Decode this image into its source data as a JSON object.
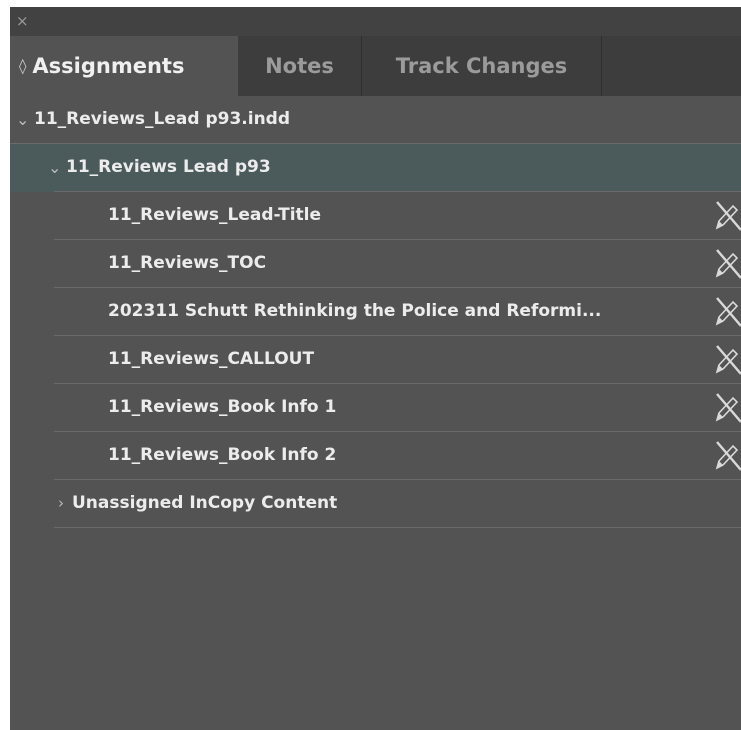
{
  "panel": {
    "close_glyph": "×"
  },
  "tabs": [
    {
      "label": "Assignments",
      "active": true
    },
    {
      "label": "Notes",
      "active": false
    },
    {
      "label": "Track Changes",
      "active": false
    }
  ],
  "tree": {
    "document": {
      "label": "11_Reviews_Lead p93.indd",
      "expanded": true
    },
    "assignment": {
      "label": "11_Reviews Lead p93",
      "expanded": true,
      "selected": true
    },
    "stories": [
      {
        "label": "11_Reviews_Lead-Title",
        "icon": "pencil-crossed-icon"
      },
      {
        "label": "11_Reviews_TOC",
        "icon": "pencil-crossed-icon"
      },
      {
        "label": "202311 Schutt Rethinking the Police and Reformi...",
        "icon": "pencil-crossed-icon"
      },
      {
        "label": "11_Reviews_CALLOUT",
        "icon": "pencil-crossed-icon"
      },
      {
        "label": "11_Reviews_Book Info 1",
        "icon": "pencil-crossed-icon"
      },
      {
        "label": "11_Reviews_Book Info 2",
        "icon": "pencil-crossed-icon"
      }
    ],
    "unassigned": {
      "label": "Unassigned InCopy Content",
      "expanded": false
    }
  },
  "colors": {
    "panel_bg": "#535353",
    "tabbar_bg": "#3d3d3d",
    "selected_row_bg": "#4b5a5b",
    "text": "#ececec"
  }
}
